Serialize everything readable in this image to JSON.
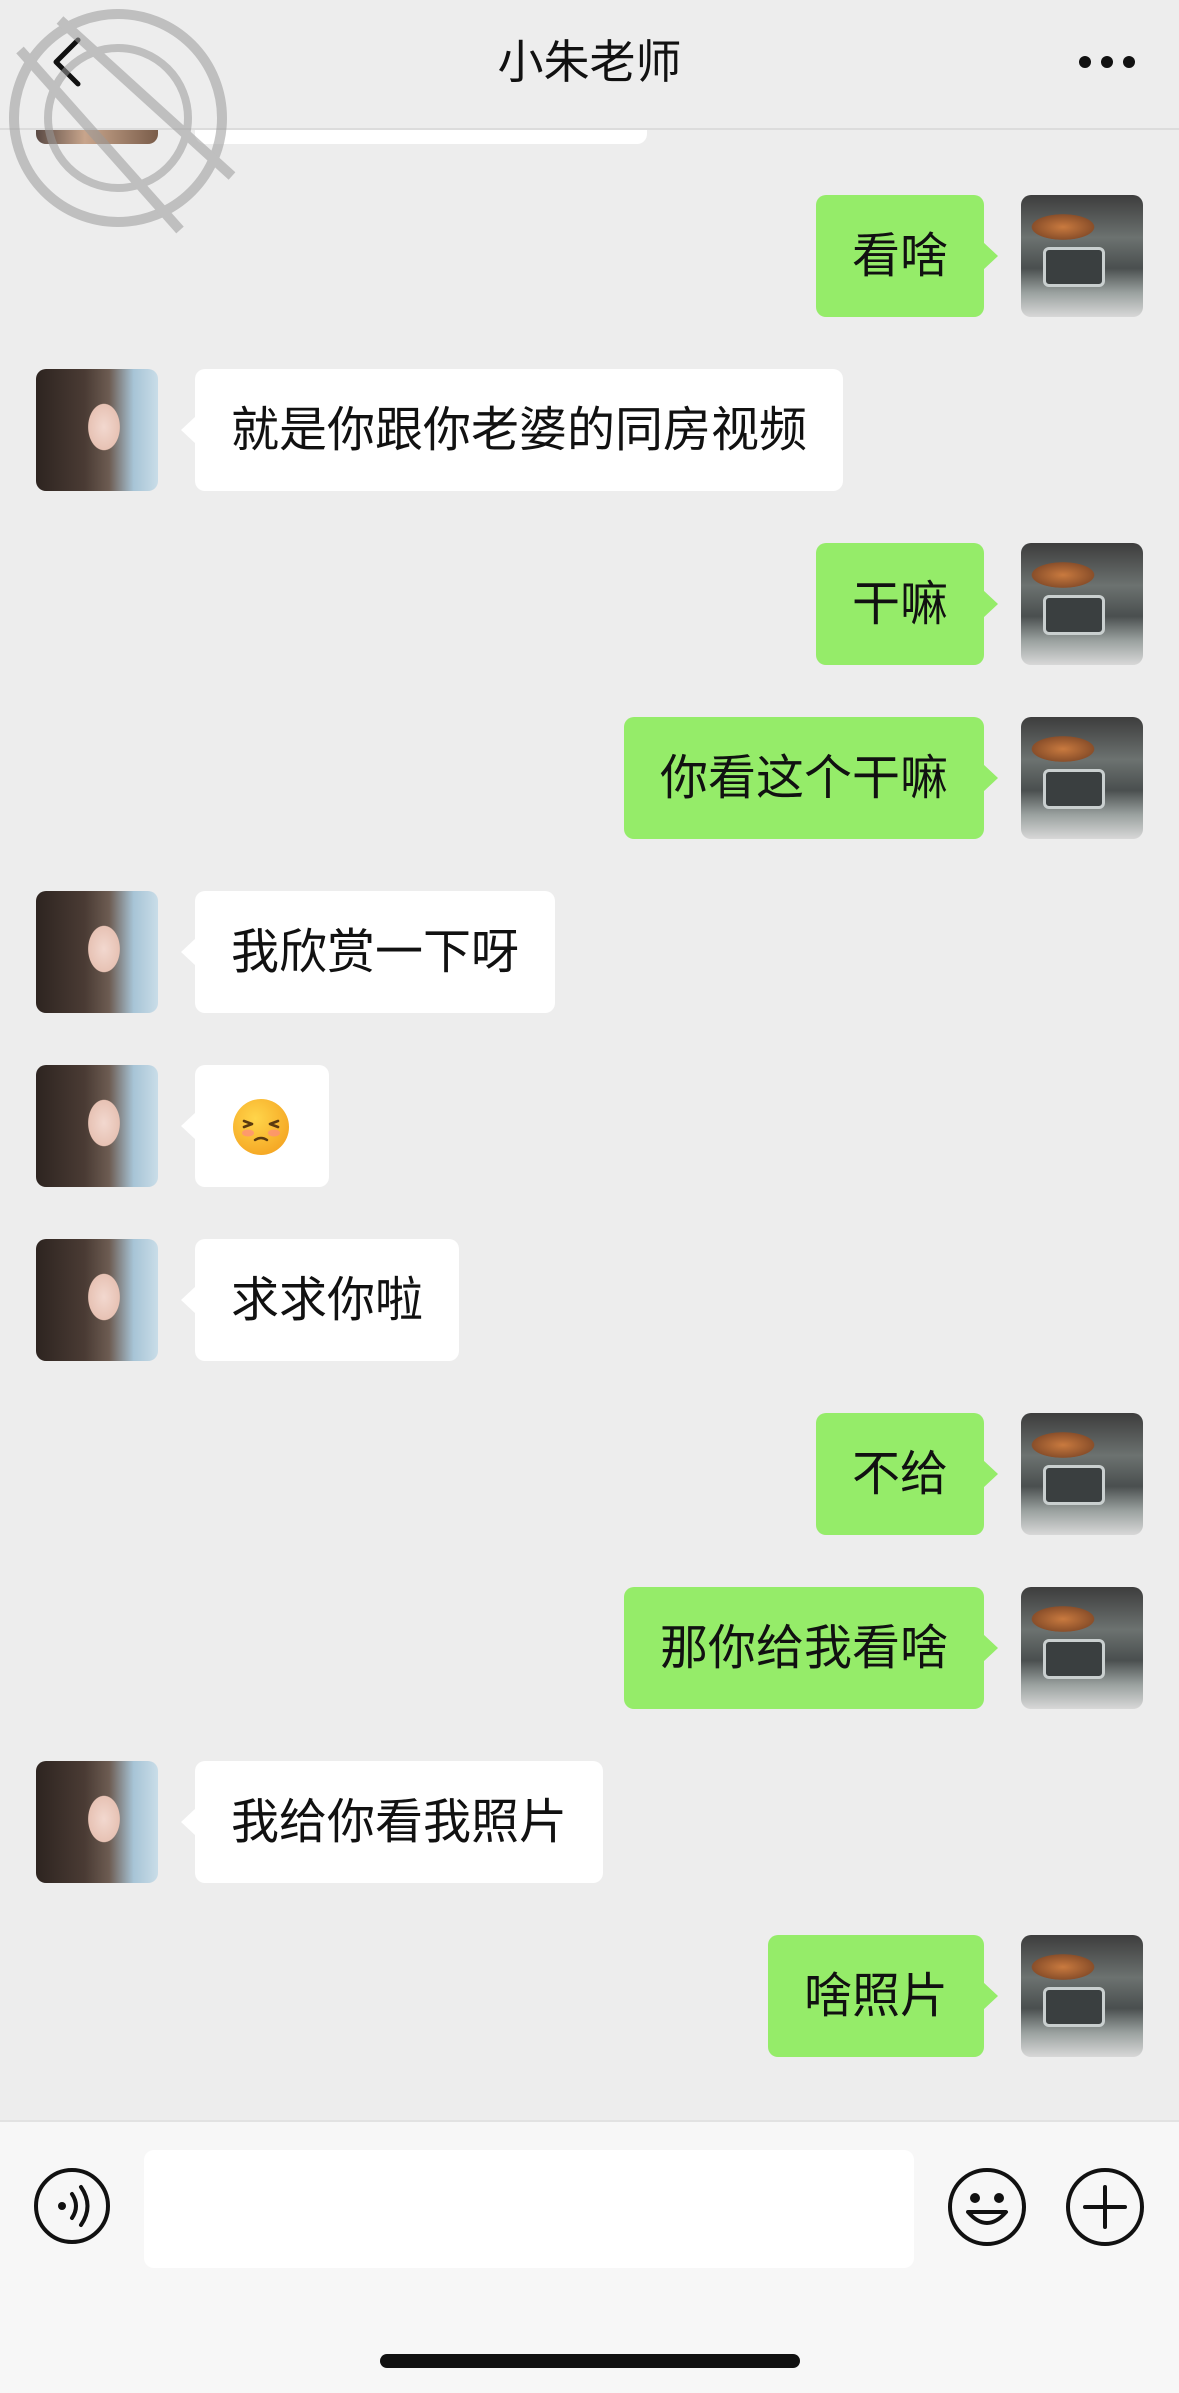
{
  "header": {
    "title": "小朱老师",
    "back_icon": "chevron-left-icon",
    "more_icon": "ellipsis-icon"
  },
  "messages": [
    {
      "from": "me",
      "text": "看啥"
    },
    {
      "from": "her",
      "text": "就是你跟你老婆的同房视频"
    },
    {
      "from": "me",
      "text": "干嘛"
    },
    {
      "from": "me",
      "text": "你看这个干嘛"
    },
    {
      "from": "her",
      "text": "我欣赏一下呀"
    },
    {
      "from": "her",
      "text": "",
      "emoji": "pleading-face-emoji"
    },
    {
      "from": "her",
      "text": "求求你啦"
    },
    {
      "from": "me",
      "text": "不给"
    },
    {
      "from": "me",
      "text": "那你给我看啥"
    },
    {
      "from": "her",
      "text": "我给你看我照片"
    },
    {
      "from": "me",
      "text": "啥照片"
    }
  ],
  "input_bar": {
    "value": "",
    "voice_icon": "voice-icon",
    "emoji_icon": "smiley-icon",
    "plus_icon": "plus-icon"
  },
  "colors": {
    "background": "#ededed",
    "outgoing_bubble": "#95ec69",
    "incoming_bubble": "#ffffff"
  }
}
